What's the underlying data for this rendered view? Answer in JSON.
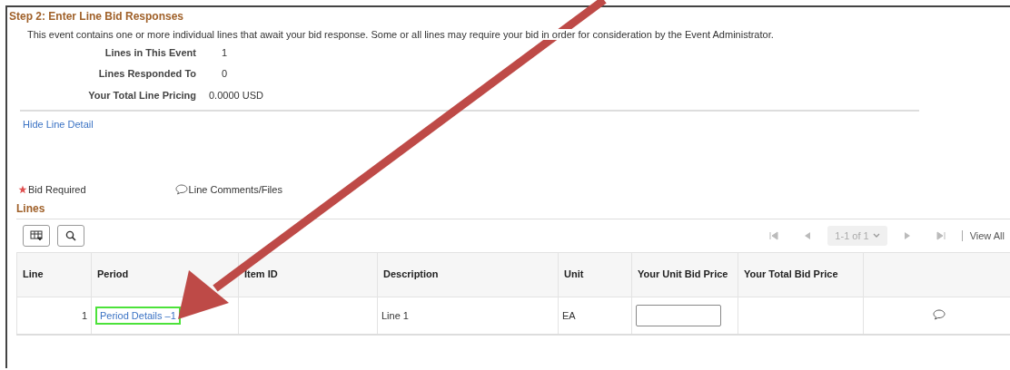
{
  "title": "Step 2: Enter Line Bid Responses",
  "intro": "This event contains one or more individual lines that await your bid response. Some or all lines may require your bid in order for consideration by the Event Administrator.",
  "summary": [
    {
      "label": "Lines in This Event",
      "value": "1"
    },
    {
      "label": "Lines Responded To",
      "value": "0"
    },
    {
      "label": "Your Total Line Pricing",
      "value": "0.0000 USD"
    }
  ],
  "detail_link": "Hide Line Detail",
  "legend": [
    {
      "kind": "star",
      "label": "Bid Required"
    },
    {
      "kind": "comment",
      "label": "Line Comments/Files"
    }
  ],
  "lines": {
    "title": "Lines",
    "pager": {
      "range": "1-1 of 1",
      "view_all": "View All"
    },
    "columns": [
      "Line",
      "Period",
      "Item ID",
      "Description",
      "Unit",
      "Your Unit Bid Price",
      "Your Total Bid Price"
    ],
    "rows": [
      {
        "line": "1",
        "period": "Period Details –1",
        "highlighted": true,
        "item_id": "",
        "description": "Line 1",
        "unit": "EA"
      }
    ]
  },
  "annotation": {
    "kind": "arrow"
  }
}
